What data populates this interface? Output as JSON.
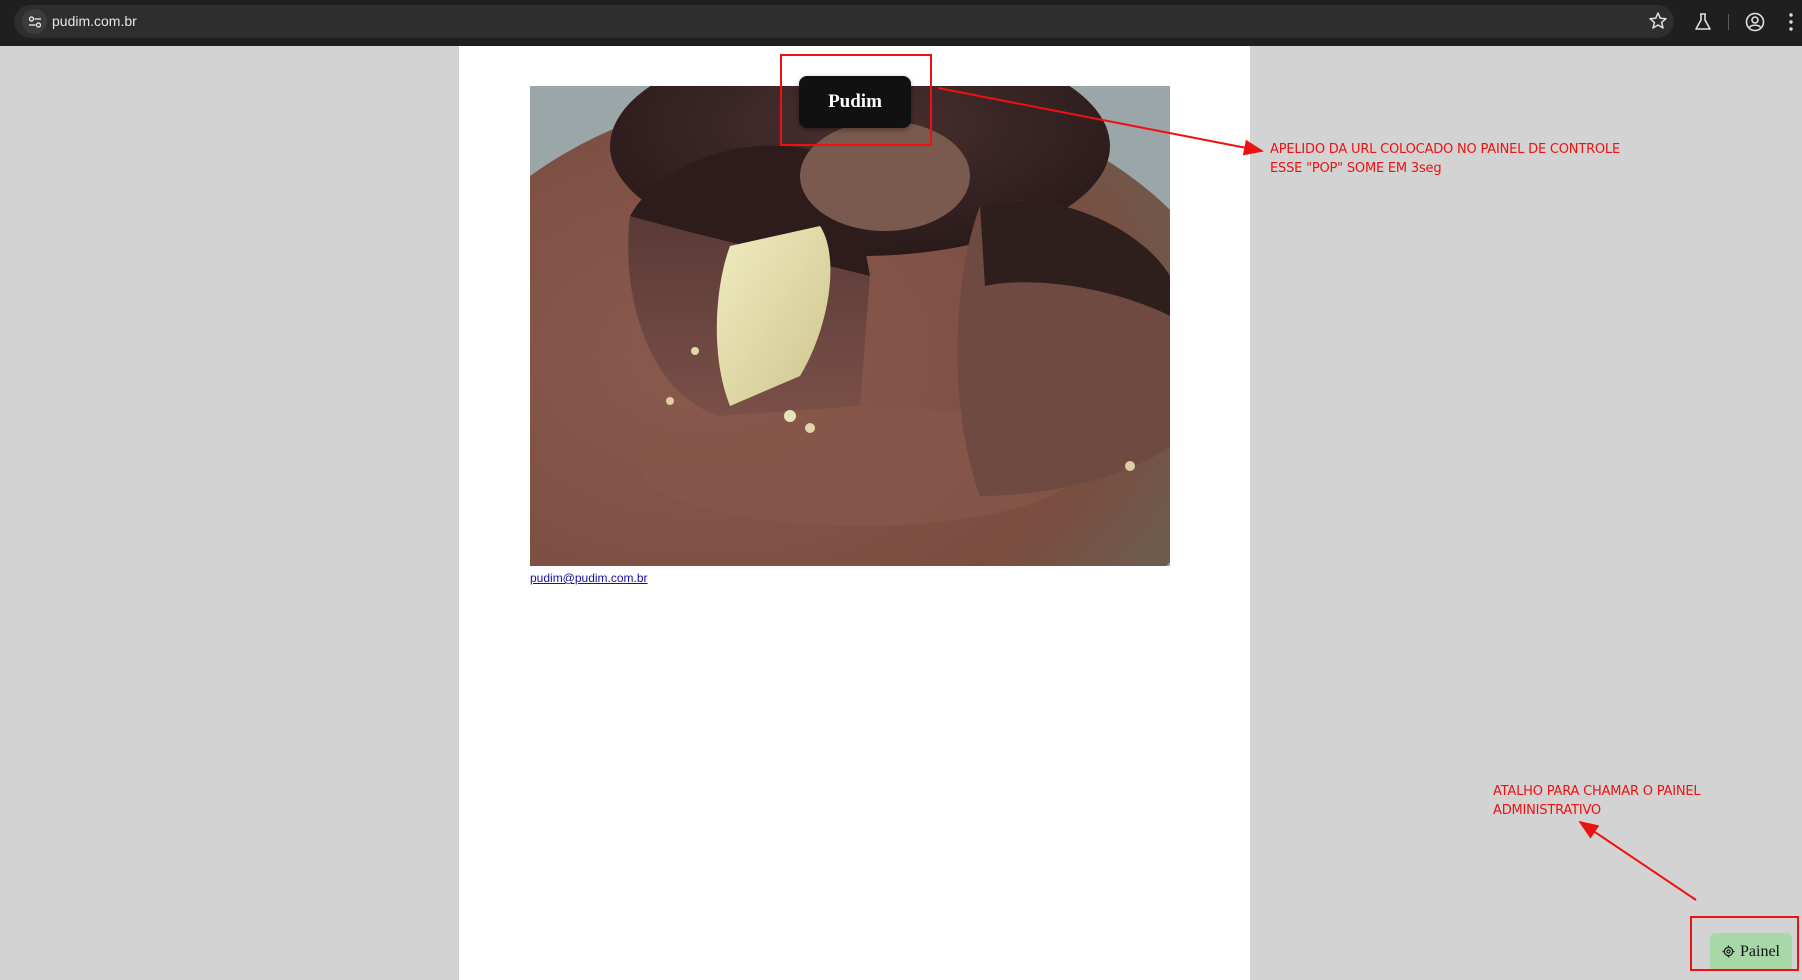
{
  "browser": {
    "url": "pudim.com.br",
    "icons": [
      "site-info-icon",
      "bookmark-star-icon",
      "labs-flask-icon",
      "profile-icon",
      "kebab-menu-icon"
    ]
  },
  "page": {
    "image": "pudim-photo",
    "email_link": "pudim@pudim.com.br"
  },
  "toast": {
    "label": "Pudim"
  },
  "painel_button": {
    "label": "Painel",
    "icon": "gear-icon",
    "color": "#a8d8a8"
  },
  "annotations": {
    "color": "#ee1111",
    "toast_note": [
      "APELIDO DA URL COLOCADO NO PAINEL DE CONTROLE",
      "ESSE \"POP\" SOME EM 3seg"
    ],
    "painel_note": [
      "ATALHO PARA CHAMAR O PAINEL",
      "ADMINISTRATIVO"
    ]
  }
}
